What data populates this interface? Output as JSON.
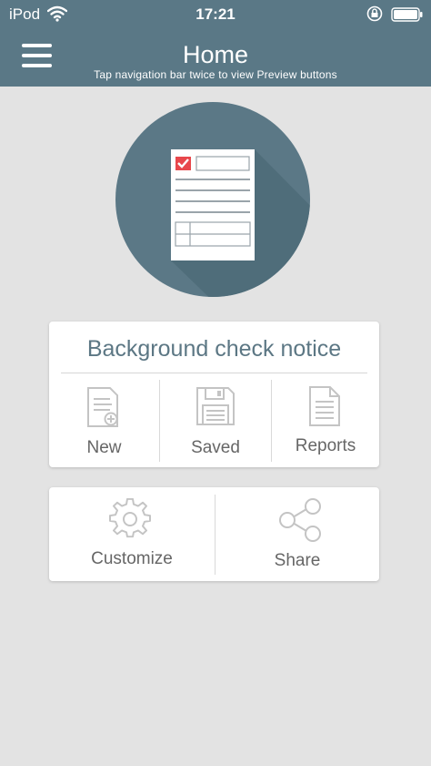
{
  "status_bar": {
    "carrier": "iPod",
    "time": "17:21"
  },
  "header": {
    "menu_icon": "hamburger-menu-icon",
    "title": "Home",
    "subtitle": "Tap navigation bar twice to view Preview buttons",
    "background_color": "#5a7886"
  },
  "hero": {
    "icon": "checklist-document-icon",
    "circle_color": "#5b7886",
    "check_color": "#e8474c"
  },
  "main_card": {
    "title": "Background check notice",
    "actions": [
      {
        "label": "New",
        "icon": "new-document-icon"
      },
      {
        "label": "Saved",
        "icon": "save-disk-icon"
      },
      {
        "label": "Reports",
        "icon": "report-document-icon"
      }
    ]
  },
  "secondary_card": {
    "actions": [
      {
        "label": "Customize",
        "icon": "gear-icon"
      },
      {
        "label": "Share",
        "icon": "share-icon"
      }
    ]
  }
}
